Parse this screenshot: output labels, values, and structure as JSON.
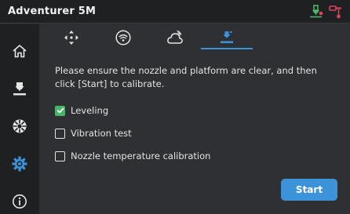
{
  "window": {
    "title": "Adventurer 5M"
  },
  "status_icons": [
    {
      "name": "nozzle-status-icon",
      "color": "#4db36b"
    },
    {
      "name": "bed-status-icon",
      "color": "#e0415a"
    }
  ],
  "sidebar": {
    "items": [
      {
        "name": "sidebar-item-home",
        "icon": "home-icon",
        "active": false
      },
      {
        "name": "sidebar-item-print",
        "icon": "printer-nozzle-icon",
        "active": false
      },
      {
        "name": "sidebar-item-filament",
        "icon": "filament-spool-icon",
        "active": false
      },
      {
        "name": "sidebar-item-settings",
        "icon": "gear-icon",
        "active": true
      },
      {
        "name": "sidebar-item-info",
        "icon": "info-icon",
        "active": false
      }
    ]
  },
  "tabs": [
    {
      "name": "tab-move",
      "icon": "move-arrows-icon",
      "active": false
    },
    {
      "name": "tab-wifi",
      "icon": "wifi-icon",
      "active": false
    },
    {
      "name": "tab-cloud",
      "icon": "cloud-icon",
      "active": false
    },
    {
      "name": "tab-calibration",
      "icon": "calibration-icon",
      "active": true
    }
  ],
  "calibration": {
    "instruction": "Please ensure the nozzle and platform are clear, and then click [Start] to calibrate.",
    "options": [
      {
        "label": "Leveling",
        "checked": true
      },
      {
        "label": "Vibration test",
        "checked": false
      },
      {
        "label": "Nozzle temperature calibration",
        "checked": false
      }
    ],
    "start_label": "Start"
  },
  "colors": {
    "accent": "#3d93d9",
    "checked": "#4db36b",
    "background": "#2f3033",
    "sidebar": "#1f2022"
  }
}
